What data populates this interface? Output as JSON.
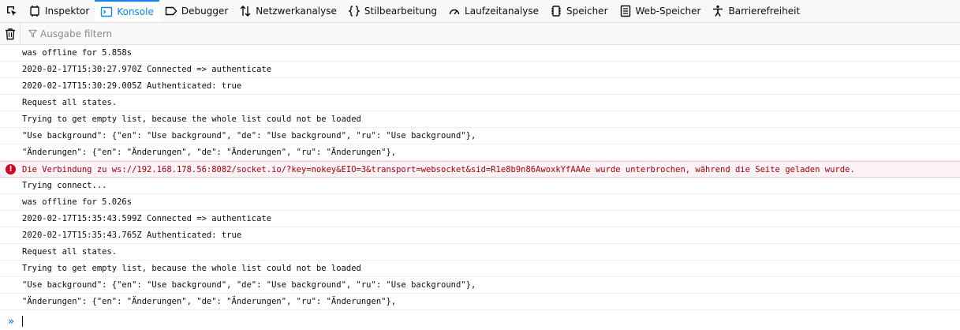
{
  "toolbar": {
    "tabs": [
      {
        "label": "Inspektor",
        "icon": "inspector-icon"
      },
      {
        "label": "Konsole",
        "icon": "console-icon",
        "active": true
      },
      {
        "label": "Debugger",
        "icon": "debugger-icon"
      },
      {
        "label": "Netzwerkanalyse",
        "icon": "network-icon"
      },
      {
        "label": "Stilbearbeitung",
        "icon": "style-editor-icon"
      },
      {
        "label": "Laufzeitanalyse",
        "icon": "performance-icon"
      },
      {
        "label": "Speicher",
        "icon": "memory-icon"
      },
      {
        "label": "Web-Speicher",
        "icon": "storage-icon"
      },
      {
        "label": "Barrierefreiheit",
        "icon": "accessibility-icon"
      }
    ],
    "accent": "#0a84ff"
  },
  "filter": {
    "placeholder": "Ausgabe filtern"
  },
  "messages": [
    {
      "text": "was offline for 5.858s"
    },
    {
      "text": "2020-02-17T15:30:27.970Z Connected => authenticate"
    },
    {
      "text": "2020-02-17T15:30:29.005Z Authenticated: true"
    },
    {
      "text": "Request all states."
    },
    {
      "text": "Trying to get empty list, because the whole list could not be loaded"
    },
    {
      "text": "\"Use background\": {\"en\": \"Use background\", \"de\": \"Use background\", \"ru\": \"Use background\"},"
    },
    {
      "text": "\"Änderungen\": {\"en\": \"Änderungen\", \"de\": \"Änderungen\", \"ru\": \"Änderungen\"},"
    },
    {
      "text": "Die Verbindung zu ws://192.168.178.56:8082/socket.io/?key=nokey&EIO=3&transport=websocket&sid=R1e8b9n86AwoxkYfAAAe wurde unterbrochen, während die Seite geladen wurde.",
      "level": "error"
    },
    {
      "text": "Trying connect..."
    },
    {
      "text": "was offline for 5.026s"
    },
    {
      "text": "2020-02-17T15:35:43.599Z Connected => authenticate"
    },
    {
      "text": "2020-02-17T15:35:43.765Z Authenticated: true"
    },
    {
      "text": "Request all states."
    },
    {
      "text": "Trying to get empty list, because the whole list could not be loaded"
    },
    {
      "text": "\"Use background\": {\"en\": \"Use background\", \"de\": \"Use background\", \"ru\": \"Use background\"},"
    },
    {
      "text": "\"Änderungen\": {\"en\": \"Änderungen\", \"de\": \"Änderungen\", \"ru\": \"Änderungen\"},"
    }
  ],
  "colors": {
    "error_bg": "#fdf2f5",
    "error_text": "#a4000f",
    "error_icon": "#d70022"
  }
}
